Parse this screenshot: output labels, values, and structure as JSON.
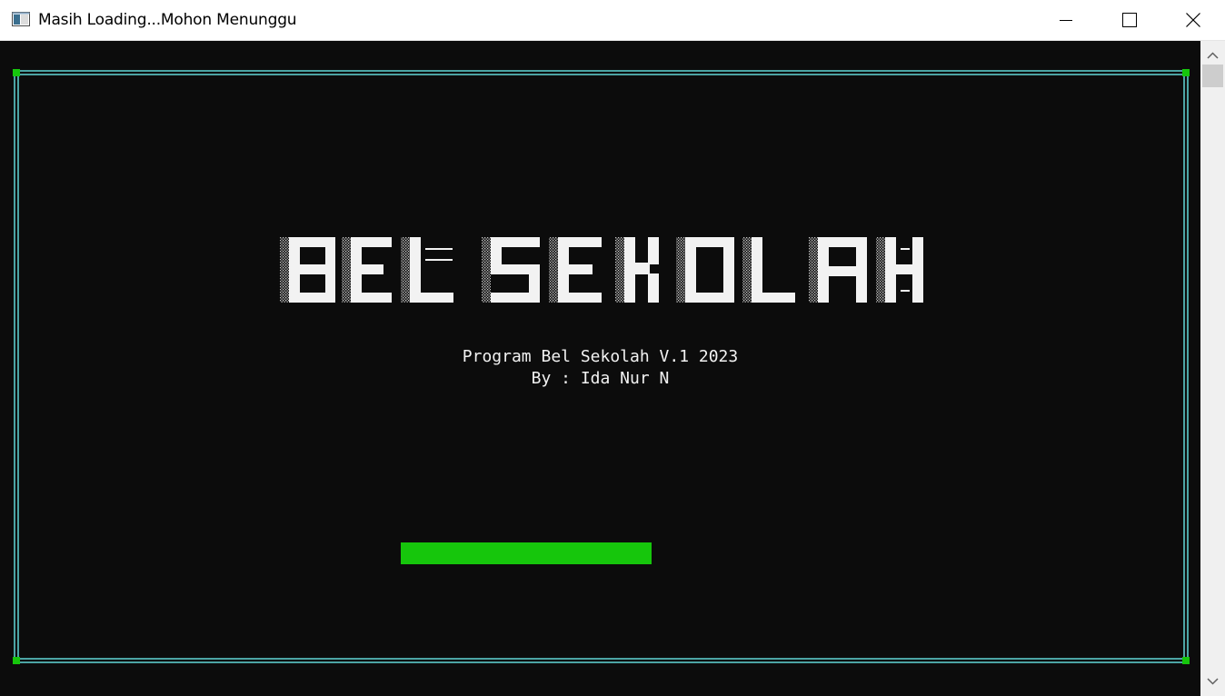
{
  "window": {
    "title": "Masih Loading...Mohon Menunggu",
    "icon": "console-window-icon",
    "buttons": [
      "minimize",
      "maximize",
      "close"
    ]
  },
  "console": {
    "banner": "BEL SEKOLAH",
    "subtitle": "Program Bel Sekolah V.1 2023",
    "author": "By : Ida Nur N",
    "progress": 0.53
  },
  "colors": {
    "background": "#0c0c0c",
    "frame": "#61d6d6",
    "frame_corner": "#16c60c",
    "progress": "#16c60c",
    "text": "#f2f2f2"
  }
}
